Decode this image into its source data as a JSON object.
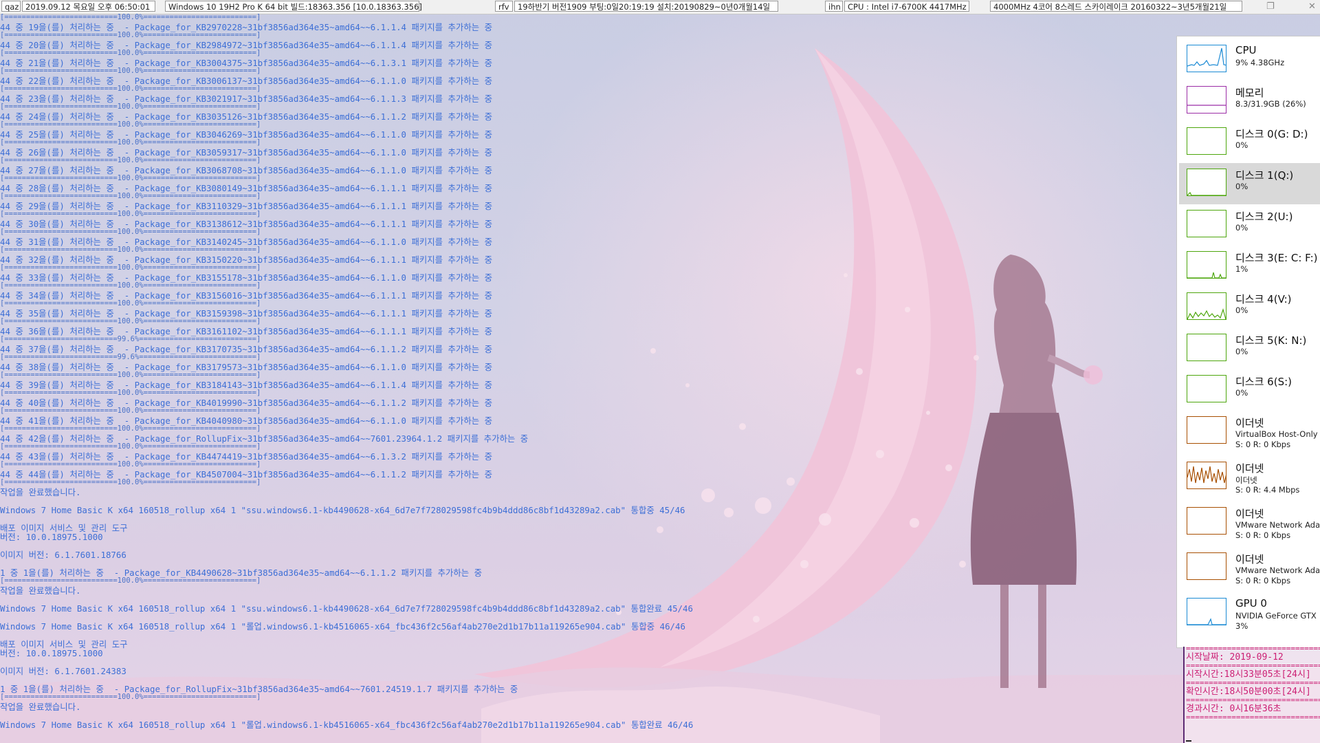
{
  "topbar": {
    "user": "qaz",
    "datetime": "2019.09.12 목요일 오후 06:50:01",
    "os": "Windows 10 19H2 Pro K 64 bit 빌드:18363.356 [10.0.18363.356]",
    "tag2": "rfv",
    "version": "19하반기 버전1909 부팅:0일20:19:19 설치:20190829~0년0개월14일",
    "tag3": "ihn",
    "cpu": "CPU : Intel i7-6700K 4417MHz",
    "cpu_detail": "4000MHz 4코어 8스레드 스카이레이크 20160322~3년5개월21일",
    "restore_glyph": "❐",
    "close_glyph": "✕"
  },
  "console": {
    "lines": [
      {
        "t": "sep",
        "s": "[==========================100.0%==========================]"
      },
      {
        "t": "ln",
        "s": "44 중 19을(를) 처리하는 중  - Package_for_KB2970228~31bf3856ad364e35~amd64~~6.1.1.4 패키지를 추가하는 중"
      },
      {
        "t": "sep",
        "s": "[==========================100.0%==========================]"
      },
      {
        "t": "ln",
        "s": "44 중 20을(를) 처리하는 중  - Package_for_KB2984972~31bf3856ad364e35~amd64~~6.1.1.4 패키지를 추가하는 중"
      },
      {
        "t": "sep",
        "s": "[==========================100.0%==========================]"
      },
      {
        "t": "ln",
        "s": "44 중 21을(를) 처리하는 중  - Package_for_KB3004375~31bf3856ad364e35~amd64~~6.1.3.1 패키지를 추가하는 중"
      },
      {
        "t": "sep",
        "s": "[==========================100.0%==========================]"
      },
      {
        "t": "ln",
        "s": "44 중 22을(를) 처리하는 중  - Package_for_KB3006137~31bf3856ad364e35~amd64~~6.1.1.0 패키지를 추가하는 중"
      },
      {
        "t": "sep",
        "s": "[==========================100.0%==========================]"
      },
      {
        "t": "ln",
        "s": "44 중 23을(를) 처리하는 중  - Package_for_KB3021917~31bf3856ad364e35~amd64~~6.1.1.3 패키지를 추가하는 중"
      },
      {
        "t": "sep",
        "s": "[==========================100.0%==========================]"
      },
      {
        "t": "ln",
        "s": "44 중 24을(를) 처리하는 중  - Package_for_KB3035126~31bf3856ad364e35~amd64~~6.1.1.2 패키지를 추가하는 중"
      },
      {
        "t": "sep",
        "s": "[==========================100.0%==========================]"
      },
      {
        "t": "ln",
        "s": "44 중 25을(를) 처리하는 중  - Package_for_KB3046269~31bf3856ad364e35~amd64~~6.1.1.0 패키지를 추가하는 중"
      },
      {
        "t": "sep",
        "s": "[==========================100.0%==========================]"
      },
      {
        "t": "ln",
        "s": "44 중 26을(를) 처리하는 중  - Package_for_KB3059317~31bf3856ad364e35~amd64~~6.1.1.0 패키지를 추가하는 중"
      },
      {
        "t": "sep",
        "s": "[==========================100.0%==========================]"
      },
      {
        "t": "ln",
        "s": "44 중 27을(를) 처리하는 중  - Package_for_KB3068708~31bf3856ad364e35~amd64~~6.1.1.0 패키지를 추가하는 중"
      },
      {
        "t": "sep",
        "s": "[==========================100.0%==========================]"
      },
      {
        "t": "ln",
        "s": "44 중 28을(를) 처리하는 중  - Package_for_KB3080149~31bf3856ad364e35~amd64~~6.1.1.1 패키지를 추가하는 중"
      },
      {
        "t": "sep",
        "s": "[==========================100.0%==========================]"
      },
      {
        "t": "ln",
        "s": "44 중 29을(를) 처리하는 중  - Package_for_KB3110329~31bf3856ad364e35~amd64~~6.1.1.1 패키지를 추가하는 중"
      },
      {
        "t": "sep",
        "s": "[==========================100.0%==========================]"
      },
      {
        "t": "ln",
        "s": "44 중 30을(를) 처리하는 중  - Package_for_KB3138612~31bf3856ad364e35~amd64~~6.1.1.1 패키지를 추가하는 중"
      },
      {
        "t": "sep",
        "s": "[==========================100.0%==========================]"
      },
      {
        "t": "ln",
        "s": "44 중 31을(를) 처리하는 중  - Package_for_KB3140245~31bf3856ad364e35~amd64~~6.1.1.0 패키지를 추가하는 중"
      },
      {
        "t": "sep",
        "s": "[==========================100.0%==========================]"
      },
      {
        "t": "ln",
        "s": "44 중 32을(를) 처리하는 중  - Package_for_KB3150220~31bf3856ad364e35~amd64~~6.1.1.1 패키지를 추가하는 중"
      },
      {
        "t": "sep",
        "s": "[==========================100.0%==========================]"
      },
      {
        "t": "ln",
        "s": "44 중 33을(를) 처리하는 중  - Package_for_KB3155178~31bf3856ad364e35~amd64~~6.1.1.0 패키지를 추가하는 중"
      },
      {
        "t": "sep",
        "s": "[==========================100.0%==========================]"
      },
      {
        "t": "ln",
        "s": "44 중 34을(를) 처리하는 중  - Package_for_KB3156016~31bf3856ad364e35~amd64~~6.1.1.1 패키지를 추가하는 중"
      },
      {
        "t": "sep",
        "s": "[==========================100.0%==========================]"
      },
      {
        "t": "ln",
        "s": "44 중 35을(를) 처리하는 중  - Package_for_KB3159398~31bf3856ad364e35~amd64~~6.1.1.1 패키지를 추가하는 중"
      },
      {
        "t": "sep",
        "s": "[==========================100.0%==========================]"
      },
      {
        "t": "ln",
        "s": "44 중 36을(를) 처리하는 중  - Package_for_KB3161102~31bf3856ad364e35~amd64~~6.1.1.1 패키지를 추가하는 중"
      },
      {
        "t": "sep",
        "s": "[==========================99.6%===========================]"
      },
      {
        "t": "ln",
        "s": "44 중 37을(를) 처리하는 중  - Package_for_KB3170735~31bf3856ad364e35~amd64~~6.1.1.2 패키지를 추가하는 중"
      },
      {
        "t": "sep",
        "s": "[==========================99.6%===========================]"
      },
      {
        "t": "ln",
        "s": "44 중 38을(를) 처리하는 중  - Package_for_KB3179573~31bf3856ad364e35~amd64~~6.1.1.0 패키지를 추가하는 중"
      },
      {
        "t": "sep",
        "s": "[==========================100.0%==========================]"
      },
      {
        "t": "ln",
        "s": "44 중 39을(를) 처리하는 중  - Package_for_KB3184143~31bf3856ad364e35~amd64~~6.1.1.4 패키지를 추가하는 중"
      },
      {
        "t": "sep",
        "s": "[==========================100.0%==========================]"
      },
      {
        "t": "ln",
        "s": "44 중 40을(를) 처리하는 중  - Package_for_KB4019990~31bf3856ad364e35~amd64~~6.1.1.2 패키지를 추가하는 중"
      },
      {
        "t": "sep",
        "s": "[==========================100.0%==========================]"
      },
      {
        "t": "ln",
        "s": "44 중 41을(를) 처리하는 중  - Package_for_KB4040980~31bf3856ad364e35~amd64~~6.1.1.0 패키지를 추가하는 중"
      },
      {
        "t": "sep",
        "s": "[==========================100.0%==========================]"
      },
      {
        "t": "ln",
        "s": "44 중 42을(를) 처리하는 중  - Package_for_RollupFix~31bf3856ad364e35~amd64~~7601.23964.1.2 패키지를 추가하는 중"
      },
      {
        "t": "sep",
        "s": "[==========================100.0%==========================]"
      },
      {
        "t": "ln",
        "s": "44 중 43을(를) 처리하는 중  - Package_for_KB4474419~31bf3856ad364e35~amd64~~6.1.3.2 패키지를 추가하는 중"
      },
      {
        "t": "sep",
        "s": "[==========================100.0%==========================]"
      },
      {
        "t": "ln",
        "s": "44 중 44을(를) 처리하는 중  - Package_for_KB4507004~31bf3856ad364e35~amd64~~6.1.1.2 패키지를 추가하는 중"
      },
      {
        "t": "sep",
        "s": "[==========================100.0%==========================]"
      },
      {
        "t": "ln",
        "s": "작업을 완료했습니다."
      },
      {
        "t": "gap",
        "s": ""
      },
      {
        "t": "ln",
        "s": "Windows 7 Home Basic K x64 160518_rollup x64 1 \"ssu.windows6.1-kb4490628-x64_6d7e7f728029598fc4b9b4ddd86c8bf1d43289a2.cab\" 통합중 45/46"
      },
      {
        "t": "gap",
        "s": ""
      },
      {
        "t": "ln",
        "s": "배포 이미지 서비스 및 관리 도구"
      },
      {
        "t": "ln",
        "s": "버전: 10.0.18975.1000"
      },
      {
        "t": "gap",
        "s": ""
      },
      {
        "t": "ln",
        "s": "이미지 버전: 6.1.7601.18766"
      },
      {
        "t": "gap",
        "s": ""
      },
      {
        "t": "ln",
        "s": "1 중 1을(를) 처리하는 중  - Package_for_KB4490628~31bf3856ad364e35~amd64~~6.1.1.2 패키지를 추가하는 중"
      },
      {
        "t": "sep",
        "s": "[==========================100.0%==========================]"
      },
      {
        "t": "ln",
        "s": "작업을 완료했습니다."
      },
      {
        "t": "gap",
        "s": ""
      },
      {
        "t": "ln",
        "s": "Windows 7 Home Basic K x64 160518_rollup x64 1 \"ssu.windows6.1-kb4490628-x64_6d7e7f728029598fc4b9b4ddd86c8bf1d43289a2.cab\" 통합완료 45/46"
      },
      {
        "t": "gap",
        "s": ""
      },
      {
        "t": "ln",
        "s": "Windows 7 Home Basic K x64 160518_rollup x64 1 \"롤업.windows6.1-kb4516065-x64_fbc436f2c56af4ab270e2d1b17b11a119265e904.cab\" 통합중 46/46"
      },
      {
        "t": "gap",
        "s": ""
      },
      {
        "t": "ln",
        "s": "배포 이미지 서비스 및 관리 도구"
      },
      {
        "t": "ln",
        "s": "버전: 10.0.18975.1000"
      },
      {
        "t": "gap",
        "s": ""
      },
      {
        "t": "ln",
        "s": "이미지 버전: 6.1.7601.24383"
      },
      {
        "t": "gap",
        "s": ""
      },
      {
        "t": "ln",
        "s": "1 중 1을(를) 처리하는 중  - Package_for_RollupFix~31bf3856ad364e35~amd64~~7601.24519.1.7 패키지를 추가하는 중"
      },
      {
        "t": "sep",
        "s": "[==========================100.0%==========================]"
      },
      {
        "t": "ln",
        "s": "작업을 완료했습니다."
      },
      {
        "t": "gap",
        "s": ""
      },
      {
        "t": "ln",
        "s": "Windows 7 Home Basic K x64 160518_rollup x64 1 \"롤업.windows6.1-kb4516065-x64_fbc436f2c56af4ab270e2d1b17b11a119265e904.cab\" 통합완료 46/46"
      }
    ]
  },
  "perf": {
    "items": [
      {
        "name": "cpu",
        "title": "CPU",
        "sub": "9% 4.38GHz",
        "color": "#1a8ad4",
        "icon": "cpu-graph-icon"
      },
      {
        "name": "memory",
        "title": "메모리",
        "sub": "8.3/31.9GB (26%)",
        "color": "#9b2ca6",
        "icon": "memory-graph-icon"
      },
      {
        "name": "disk0",
        "title": "디스크 0(G: D:)",
        "sub": "0%",
        "color": "#4da60c",
        "icon": "disk-graph-icon"
      },
      {
        "name": "disk1",
        "title": "디스크 1(Q:)",
        "sub": "0%",
        "color": "#4da60c",
        "icon": "disk-graph-icon",
        "selected": true
      },
      {
        "name": "disk2",
        "title": "디스크 2(U:)",
        "sub": "0%",
        "color": "#4da60c",
        "icon": "disk-graph-icon"
      },
      {
        "name": "disk3",
        "title": "디스크 3(E: C: F:)",
        "sub": "1%",
        "color": "#4da60c",
        "icon": "disk-graph-icon"
      },
      {
        "name": "disk4",
        "title": "디스크 4(V:)",
        "sub": "0%",
        "color": "#4da60c",
        "icon": "disk-graph-icon"
      },
      {
        "name": "disk5",
        "title": "디스크 5(K: N:)",
        "sub": "0%",
        "color": "#4da60c",
        "icon": "disk-graph-icon"
      },
      {
        "name": "disk6",
        "title": "디스크 6(S:)",
        "sub": "0%",
        "color": "#4da60c",
        "icon": "disk-graph-icon"
      },
      {
        "name": "ethernet1",
        "title": "이더넷",
        "sub": "VirtualBox Host-Only ...",
        "sub2": "S: 0 R: 0 Kbps",
        "color": "#a74f01",
        "icon": "network-graph-icon"
      },
      {
        "name": "ethernet2",
        "title": "이더넷",
        "sub": "이더넷",
        "sub2": "S: 0 R: 4.4 Mbps",
        "color": "#a74f01",
        "icon": "network-graph-icon"
      },
      {
        "name": "ethernet3",
        "title": "이더넷",
        "sub": "VMware Network Ada...",
        "sub2": "S: 0 R: 0 Kbps",
        "color": "#a74f01",
        "icon": "network-graph-icon"
      },
      {
        "name": "ethernet4",
        "title": "이더넷",
        "sub": "VMware Network Ada...",
        "sub2": "S: 0 R: 0 Kbps",
        "color": "#a74f01",
        "icon": "network-graph-icon"
      },
      {
        "name": "gpu0",
        "title": "GPU 0",
        "sub": "NVIDIA GeForce GTX ...",
        "sub2": "3%",
        "color": "#1a8ad4",
        "icon": "gpu-graph-icon"
      }
    ]
  },
  "timing": {
    "sep": "==================================",
    "start_date": "시작날짜: 2019-09-12",
    "start_time": "시작시간:18시33분05초[24시]",
    "check_time": "확인시간:18시50분00초[24시]",
    "elapsed": "경과시간: 0시16분36초"
  }
}
